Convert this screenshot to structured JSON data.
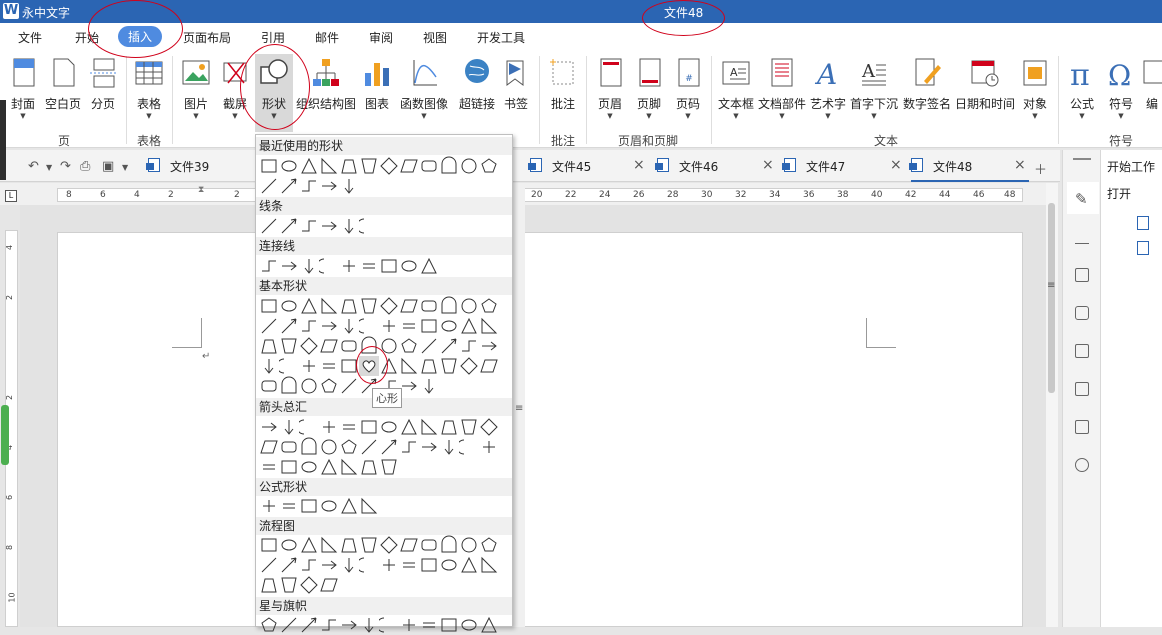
{
  "title_bar": {
    "app_name": "永中文字",
    "document_title": "文件48"
  },
  "menu": [
    "文件",
    "开始",
    "插入",
    "页面布局",
    "引用",
    "邮件",
    "审阅",
    "视图",
    "开发工具"
  ],
  "ribbon": {
    "buttons": [
      {
        "label": "封面",
        "icon": "cover-page-icon",
        "caret": true
      },
      {
        "label": "空白页",
        "icon": "blank-page-icon",
        "caret": false
      },
      {
        "label": "分页",
        "icon": "page-break-icon",
        "caret": false
      },
      {
        "label": "表格",
        "icon": "table-icon",
        "caret": true
      },
      {
        "label": "图片",
        "icon": "picture-icon",
        "caret": true
      },
      {
        "label": "截屏",
        "icon": "screenshot-icon",
        "caret": true
      },
      {
        "label": "形状",
        "icon": "shapes-icon",
        "caret": true
      },
      {
        "label": "组织结构图",
        "icon": "org-chart-icon",
        "caret": false
      },
      {
        "label": "图表",
        "icon": "chart-icon",
        "caret": false
      },
      {
        "label": "函数图像",
        "icon": "function-graph-icon",
        "caret": true
      },
      {
        "label": "超链接",
        "icon": "hyperlink-icon",
        "caret": false
      },
      {
        "label": "书签",
        "icon": "bookmark-icon",
        "caret": false
      },
      {
        "label": "批注",
        "icon": "comment-icon",
        "caret": false
      },
      {
        "label": "页眉",
        "icon": "header-icon",
        "caret": true
      },
      {
        "label": "页脚",
        "icon": "footer-icon",
        "caret": true
      },
      {
        "label": "页码",
        "icon": "page-number-icon",
        "caret": true
      },
      {
        "label": "文本框",
        "icon": "textbox-icon",
        "caret": true
      },
      {
        "label": "文档部件",
        "icon": "doc-parts-icon",
        "caret": true
      },
      {
        "label": "艺术字",
        "icon": "wordart-icon",
        "caret": true
      },
      {
        "label": "首字下沉",
        "icon": "drop-cap-icon",
        "caret": true
      },
      {
        "label": "数字签名",
        "icon": "signature-icon",
        "caret": false
      },
      {
        "label": "日期和时间",
        "icon": "date-time-icon",
        "caret": false
      },
      {
        "label": "对象",
        "icon": "object-icon",
        "caret": true
      },
      {
        "label": "公式",
        "icon": "pi-icon",
        "caret": true
      },
      {
        "label": "符号",
        "icon": "omega-icon",
        "caret": true
      },
      {
        "label": "编",
        "icon": "numbering-icon",
        "caret": false
      }
    ],
    "groups": [
      "页",
      "表格",
      "批注",
      "页眉和页脚",
      "文本",
      "符号"
    ]
  },
  "tabs": [
    "文件39",
    "文件45",
    "文件46",
    "文件47",
    "文件48"
  ],
  "active_tab": "文件48",
  "ruler_h": [
    "8",
    "6",
    "4",
    "2",
    "2",
    "20",
    "22",
    "24",
    "26",
    "28",
    "30",
    "32",
    "34",
    "36",
    "38",
    "40",
    "42",
    "44",
    "46",
    "48"
  ],
  "ruler_v": [
    "4",
    "2",
    "2",
    "4",
    "6",
    "8",
    "10"
  ],
  "shapes_panel": {
    "categories": [
      "最近使用的形状",
      "线条",
      "连接线",
      "基本形状",
      "箭头总汇",
      "公式形状",
      "流程图",
      "星与旗帜"
    ],
    "tooltip": "心形"
  },
  "task_pane": {
    "title": "开始工作",
    "open": "打开"
  },
  "colors": {
    "title_bar": "#2b65b3",
    "accent": "#4f8be0",
    "annotation": "#d0021b"
  }
}
